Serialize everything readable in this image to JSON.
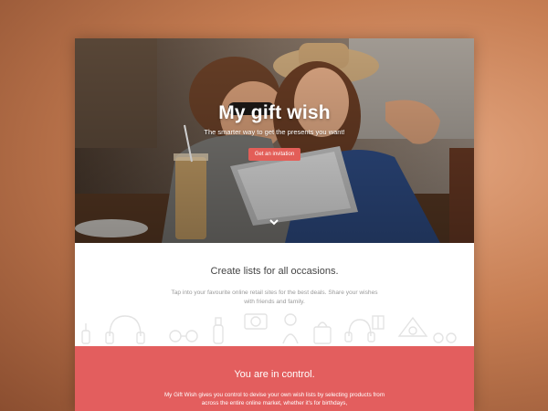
{
  "hero": {
    "title": "My gift wish",
    "subtitle": "The smarter way to get the presents you want!",
    "cta_label": "Get an invitation",
    "scroll_icon": "chevron-down-icon"
  },
  "section_occasions": {
    "title": "Create lists for all occasions.",
    "text": "Tap into your favourite online retail sites for the best deals. Share your wishes with friends and family.",
    "icons": [
      "headphones-icon",
      "glasses-icon",
      "camera-icon",
      "bottle-icon",
      "baby-icon",
      "gift-icon",
      "bag-icon"
    ]
  },
  "section_control": {
    "title": "You are in control.",
    "text": "My Gift Wish gives you control to devise your own wish lists by selecting products from across the entire online market, whether it's for birthdays,"
  },
  "colors": {
    "accent": "#e35e5e",
    "background": "#c67d52"
  }
}
